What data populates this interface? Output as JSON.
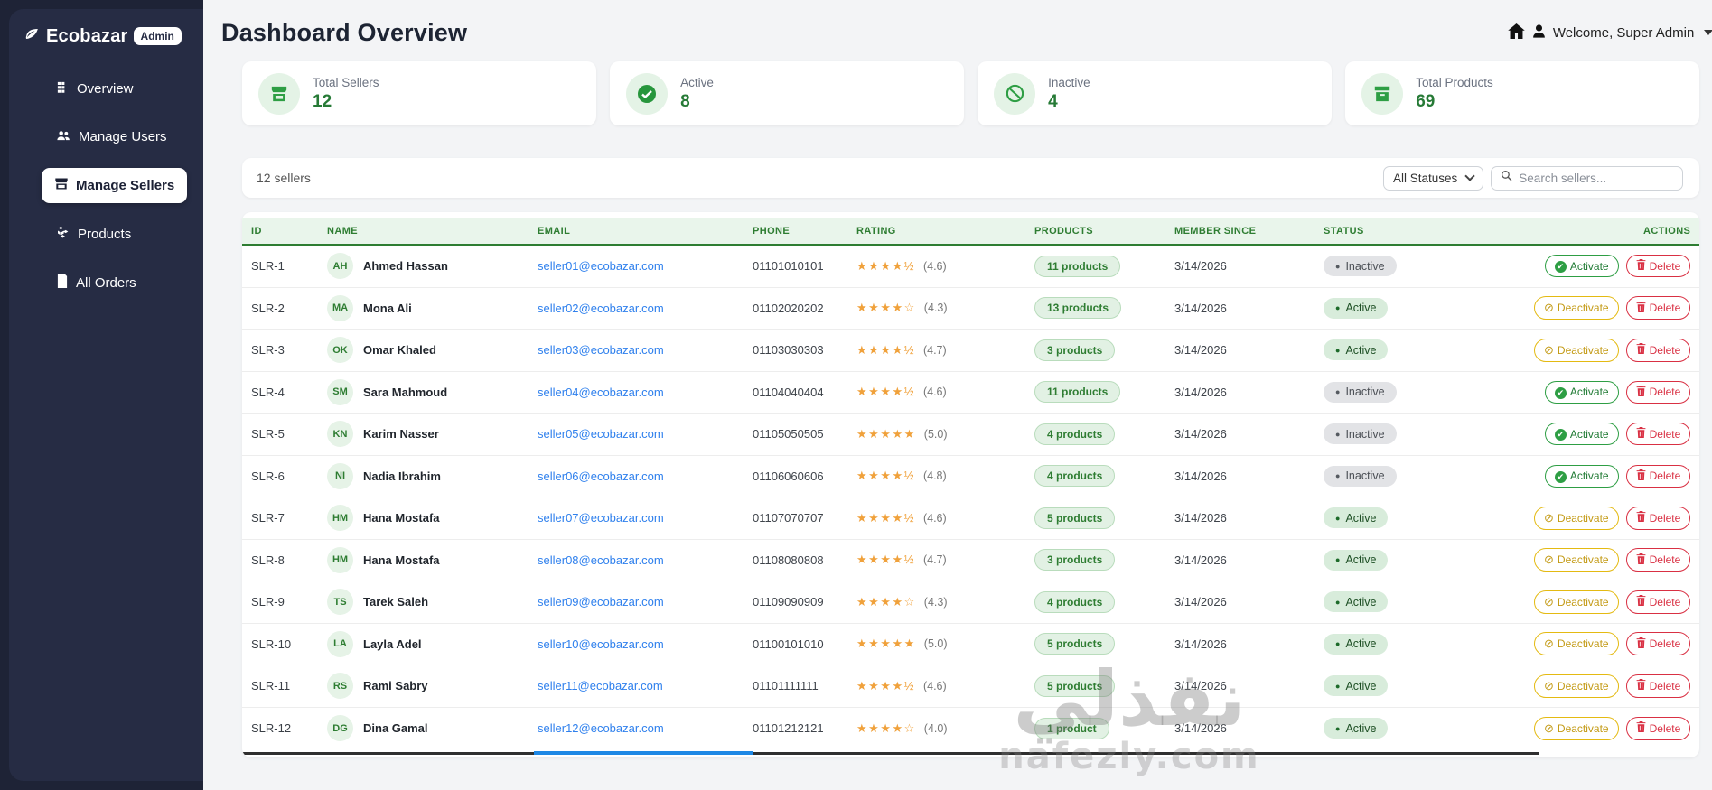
{
  "sidebar": {
    "brand": {
      "name": "Ecobazar",
      "badge": "Admin"
    },
    "items": [
      {
        "label": "Overview",
        "icon": "grid-icon",
        "active": false
      },
      {
        "label": "Manage Users",
        "icon": "users-icon",
        "active": false
      },
      {
        "label": "Manage Sellers",
        "icon": "store-icon",
        "active": true
      },
      {
        "label": "Products",
        "icon": "boxes-icon",
        "active": false
      },
      {
        "label": "All Orders",
        "icon": "file-icon",
        "active": false
      }
    ]
  },
  "header": {
    "title": "Dashboard Overview",
    "user_menu": "Welcome, Super Admin"
  },
  "stats": [
    {
      "label": "Total Sellers",
      "value": "12",
      "icon": "store-icon"
    },
    {
      "label": "Active",
      "value": "8",
      "icon": "check-circle-icon"
    },
    {
      "label": "Inactive",
      "value": "4",
      "icon": "ban-icon"
    },
    {
      "label": "Total Products",
      "value": "69",
      "icon": "box-icon"
    }
  ],
  "filters": {
    "count_label": "12 sellers",
    "status_dropdown": "All Statuses",
    "search_placeholder": "Search sellers..."
  },
  "table": {
    "columns": [
      "ID",
      "NAME",
      "EMAIL",
      "PHONE",
      "RATING",
      "PRODUCTS",
      "MEMBER SINCE",
      "STATUS",
      "ACTIONS"
    ],
    "delete_label": "Delete",
    "rows": [
      {
        "id": "SLR-1",
        "initials": "AH",
        "name": "Ahmed Hassan",
        "email": "seller01@ecobazar.com",
        "phone": "01101010101",
        "stars": "★★★★½",
        "rating": "(4.6)",
        "products": "11 products",
        "member_since": "3/14/2026",
        "status": "Inactive",
        "action": "Activate"
      },
      {
        "id": "SLR-2",
        "initials": "MA",
        "name": "Mona Ali",
        "email": "seller02@ecobazar.com",
        "phone": "01102020202",
        "stars": "★★★★☆",
        "rating": "(4.3)",
        "products": "13 products",
        "member_since": "3/14/2026",
        "status": "Active",
        "action": "Deactivate"
      },
      {
        "id": "SLR-3",
        "initials": "OK",
        "name": "Omar Khaled",
        "email": "seller03@ecobazar.com",
        "phone": "01103030303",
        "stars": "★★★★½",
        "rating": "(4.7)",
        "products": "3 products",
        "member_since": "3/14/2026",
        "status": "Active",
        "action": "Deactivate"
      },
      {
        "id": "SLR-4",
        "initials": "SM",
        "name": "Sara Mahmoud",
        "email": "seller04@ecobazar.com",
        "phone": "01104040404",
        "stars": "★★★★½",
        "rating": "(4.6)",
        "products": "11 products",
        "member_since": "3/14/2026",
        "status": "Inactive",
        "action": "Activate"
      },
      {
        "id": "SLR-5",
        "initials": "KN",
        "name": "Karim Nasser",
        "email": "seller05@ecobazar.com",
        "phone": "01105050505",
        "stars": "★★★★★",
        "rating": "(5.0)",
        "products": "4 products",
        "member_since": "3/14/2026",
        "status": "Inactive",
        "action": "Activate"
      },
      {
        "id": "SLR-6",
        "initials": "NI",
        "name": "Nadia Ibrahim",
        "email": "seller06@ecobazar.com",
        "phone": "01106060606",
        "stars": "★★★★½",
        "rating": "(4.8)",
        "products": "4 products",
        "member_since": "3/14/2026",
        "status": "Inactive",
        "action": "Activate"
      },
      {
        "id": "SLR-7",
        "initials": "HM",
        "name": "Hana Mostafa",
        "email": "seller07@ecobazar.com",
        "phone": "01107070707",
        "stars": "★★★★½",
        "rating": "(4.6)",
        "products": "5 products",
        "member_since": "3/14/2026",
        "status": "Active",
        "action": "Deactivate"
      },
      {
        "id": "SLR-8",
        "initials": "HM",
        "name": "Hana Mostafa",
        "email": "seller08@ecobazar.com",
        "phone": "01108080808",
        "stars": "★★★★½",
        "rating": "(4.7)",
        "products": "3 products",
        "member_since": "3/14/2026",
        "status": "Active",
        "action": "Deactivate"
      },
      {
        "id": "SLR-9",
        "initials": "TS",
        "name": "Tarek Saleh",
        "email": "seller09@ecobazar.com",
        "phone": "01109090909",
        "stars": "★★★★☆",
        "rating": "(4.3)",
        "products": "4 products",
        "member_since": "3/14/2026",
        "status": "Active",
        "action": "Deactivate"
      },
      {
        "id": "SLR-10",
        "initials": "LA",
        "name": "Layla Adel",
        "email": "seller10@ecobazar.com",
        "phone": "01100101010",
        "stars": "★★★★★",
        "rating": "(5.0)",
        "products": "5 products",
        "member_since": "3/14/2026",
        "status": "Active",
        "action": "Deactivate"
      },
      {
        "id": "SLR-11",
        "initials": "RS",
        "name": "Rami Sabry",
        "email": "seller11@ecobazar.com",
        "phone": "01101111111",
        "stars": "★★★★½",
        "rating": "(4.6)",
        "products": "5 products",
        "member_since": "3/14/2026",
        "status": "Active",
        "action": "Deactivate"
      },
      {
        "id": "SLR-12",
        "initials": "DG",
        "name": "Dina Gamal",
        "email": "seller12@ecobazar.com",
        "phone": "01101212121",
        "stars": "★★★★☆",
        "rating": "(4.0)",
        "products": "1 product",
        "member_since": "3/14/2026",
        "status": "Active",
        "action": "Deactivate"
      }
    ]
  },
  "watermark": {
    "arabic": "نفذلي",
    "domain": "nafezly.com"
  },
  "colors": {
    "accent_green": "#2e7d32",
    "sidebar_bg": "#262c44",
    "star_orange": "#f0a13b",
    "link_blue": "#2f80ed",
    "delete_red": "#d93043",
    "deactivate_gold": "#e4ba12",
    "scroll_thumb_blue": "#1e88e5"
  }
}
